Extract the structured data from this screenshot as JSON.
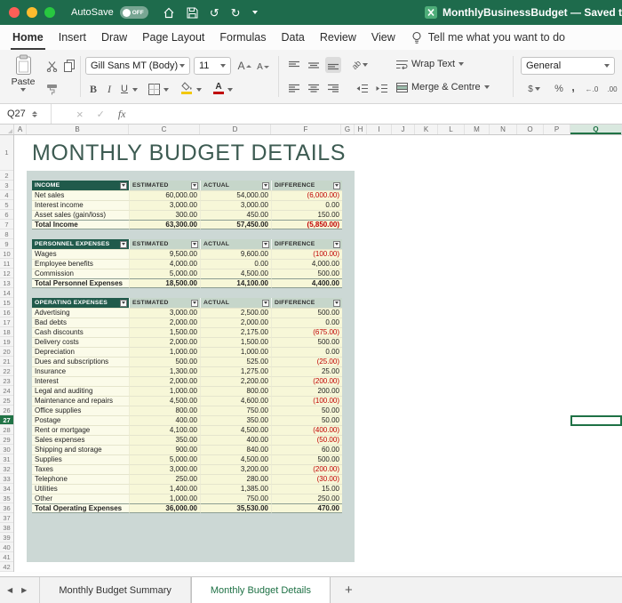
{
  "titlebar": {
    "autosave_label": "AutoSave",
    "autosave_state": "OFF",
    "doc_title": "MonthlyBusinessBudget — Saved to m"
  },
  "ribbon_tabs": {
    "tabs": [
      {
        "label": "Home",
        "active": true
      },
      {
        "label": "Insert",
        "active": false
      },
      {
        "label": "Draw",
        "active": false
      },
      {
        "label": "Page Layout",
        "active": false
      },
      {
        "label": "Formulas",
        "active": false
      },
      {
        "label": "Data",
        "active": false
      },
      {
        "label": "Review",
        "active": false
      },
      {
        "label": "View",
        "active": false
      }
    ],
    "tell_me": "Tell me what you want to do"
  },
  "ribbon": {
    "paste_label": "Paste",
    "font_name": "Gill Sans MT (Body)",
    "font_size": "11",
    "grow_font_label": "A",
    "shrink_font_label": "A",
    "bold_label": "B",
    "italic_label": "I",
    "underline_label": "U",
    "font_color_label": "A",
    "orientation_label": "ab",
    "wrap_text_label": "Wrap Text",
    "merge_label": "Merge & Centre",
    "number_format": "General",
    "currency_label": "$",
    "percent_label": "%",
    "comma_label": ",",
    "decrease_decimal_label": "←.0",
    "increase_decimal_label": ".00"
  },
  "formula_bar": {
    "name_box": "Q27",
    "cancel_label": "×",
    "enter_label": "✓",
    "fx_label": "fx"
  },
  "icons": {
    "undo": "↺",
    "redo": "↻"
  },
  "sheet": {
    "title": "MONTHLY BUDGET DETAILS",
    "columns": [
      "A",
      "B",
      "C",
      "D",
      "F",
      "G",
      "H",
      "I",
      "J",
      "K",
      "L",
      "M",
      "N",
      "O",
      "P",
      "Q"
    ],
    "row_count": 42,
    "selected_row": 27,
    "selected_col": "Q",
    "selected_cell": "Q27",
    "tables": [
      {
        "header": [
          "INCOME",
          "ESTIMATED",
          "ACTUAL",
          "DIFFERENCE"
        ],
        "rows": [
          [
            "Net sales",
            "60,000.00",
            "54,000.00",
            "(6,000.00)"
          ],
          [
            "Interest income",
            "3,000.00",
            "3,000.00",
            "0.00"
          ],
          [
            "Asset sales (gain/loss)",
            "300.00",
            "450.00",
            "150.00"
          ]
        ],
        "total": [
          "Total Income",
          "63,300.00",
          "57,450.00",
          "(5,850.00)"
        ]
      },
      {
        "header": [
          "PERSONNEL EXPENSES",
          "ESTIMATED",
          "ACTUAL",
          "DIFFERENCE"
        ],
        "rows": [
          [
            "Wages",
            "9,500.00",
            "9,600.00",
            "(100.00)"
          ],
          [
            "Employee benefits",
            "4,000.00",
            "0.00",
            "4,000.00"
          ],
          [
            "Commission",
            "5,000.00",
            "4,500.00",
            "500.00"
          ]
        ],
        "total": [
          "Total Personnel Expenses",
          "18,500.00",
          "14,100.00",
          "4,400.00"
        ]
      },
      {
        "header": [
          "OPERATING EXPENSES",
          "ESTIMATED",
          "ACTUAL",
          "DIFFERENCE"
        ],
        "rows": [
          [
            "Advertising",
            "3,000.00",
            "2,500.00",
            "500.00"
          ],
          [
            "Bad debts",
            "2,000.00",
            "2,000.00",
            "0.00"
          ],
          [
            "Cash discounts",
            "1,500.00",
            "2,175.00",
            "(675.00)"
          ],
          [
            "Delivery costs",
            "2,000.00",
            "1,500.00",
            "500.00"
          ],
          [
            "Depreciation",
            "1,000.00",
            "1,000.00",
            "0.00"
          ],
          [
            "Dues and subscriptions",
            "500.00",
            "525.00",
            "(25.00)"
          ],
          [
            "Insurance",
            "1,300.00",
            "1,275.00",
            "25.00"
          ],
          [
            "Interest",
            "2,000.00",
            "2,200.00",
            "(200.00)"
          ],
          [
            "Legal and auditing",
            "1,000.00",
            "800.00",
            "200.00"
          ],
          [
            "Maintenance and repairs",
            "4,500.00",
            "4,600.00",
            "(100.00)"
          ],
          [
            "Office supplies",
            "800.00",
            "750.00",
            "50.00"
          ],
          [
            "Postage",
            "400.00",
            "350.00",
            "50.00"
          ],
          [
            "Rent or mortgage",
            "4,100.00",
            "4,500.00",
            "(400.00)"
          ],
          [
            "Sales expenses",
            "350.00",
            "400.00",
            "(50.00)"
          ],
          [
            "Shipping and storage",
            "900.00",
            "840.00",
            "60.00"
          ],
          [
            "Supplies",
            "5,000.00",
            "4,500.00",
            "500.00"
          ],
          [
            "Taxes",
            "3,000.00",
            "3,200.00",
            "(200.00)"
          ],
          [
            "Telephone",
            "250.00",
            "280.00",
            "(30.00)"
          ],
          [
            "Utilities",
            "1,400.00",
            "1,385.00",
            "15.00"
          ],
          [
            "Other",
            "1,000.00",
            "750.00",
            "250.00"
          ]
        ],
        "total": [
          "Total Operating Expenses",
          "36,000.00",
          "35,530.00",
          "470.00"
        ]
      }
    ]
  },
  "sheet_tabs": {
    "prev_label": "◀",
    "next_label": "▶",
    "tabs": [
      {
        "label": "Monthly Budget Summary",
        "active": false
      },
      {
        "label": "Monthly Budget Details",
        "active": true
      }
    ],
    "add_label": "+"
  },
  "colors": {
    "titlebar_green": "#1e6b4c",
    "accent_green": "#217346",
    "header_dark_green": "#205a4b",
    "header_light_green": "#c6d6ca",
    "panel_blue_gray": "#ccd8d5",
    "cell_cream": "#f7f7d8",
    "negative_red": "#c00000"
  }
}
